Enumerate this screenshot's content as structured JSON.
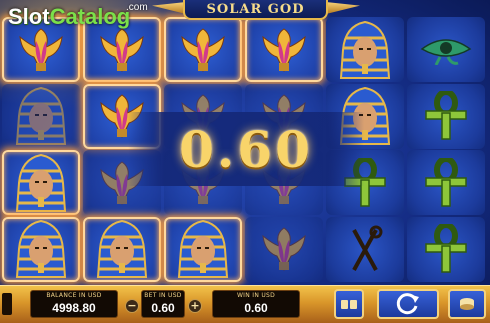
{
  "watermark": {
    "slot": "Slot",
    "catalog": "Catalog",
    "com": ".com"
  },
  "game": {
    "title": "SOLAR GOD"
  },
  "win": {
    "amount": "0.60"
  },
  "bottom_bar": {
    "balance_label": "BALANCE IN USD",
    "balance_value": "4998.80",
    "bet_label": "BET IN USD",
    "bet_value": "0.60",
    "win_label": "WIN IN USD",
    "win_value": "0.60",
    "decrease_symbol": "−",
    "increase_symbol": "+"
  },
  "reels": [
    [
      "lotus",
      "pharaoh",
      "pharaoh",
      "pharaoh"
    ],
    [
      "lotus",
      "lotus",
      "lotus",
      "pharaoh"
    ],
    [
      "lotus",
      "lotus",
      "lotus",
      "pharaoh"
    ],
    [
      "lotus",
      "lotus",
      "lotus",
      "lotus"
    ],
    [
      "pharaoh",
      "pharaoh",
      "ankh",
      "staff"
    ],
    [
      "eye",
      "ankh",
      "ankh",
      "ankh"
    ]
  ],
  "winning_cells": [
    [
      0,
      0
    ],
    [
      0,
      2
    ],
    [
      0,
      3
    ],
    [
      1,
      0
    ],
    [
      1,
      1
    ],
    [
      1,
      3
    ],
    [
      2,
      0
    ],
    [
      2,
      3
    ],
    [
      3,
      0
    ]
  ],
  "colors": {
    "highlight": "#ff9f3a",
    "win_text": "#f8d46a",
    "frame_gold": "#e7b94a"
  },
  "icons": {
    "lotus": "lotus-symbol-icon",
    "pharaoh": "pharaoh-symbol-icon",
    "ankh": "ankh-symbol-icon",
    "eye": "eye-of-horus-symbol-icon",
    "staff": "crook-and-flail-symbol-icon"
  }
}
